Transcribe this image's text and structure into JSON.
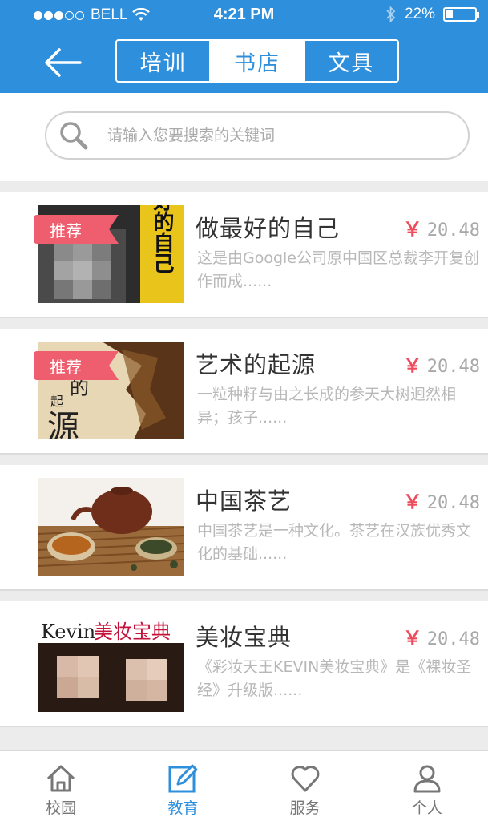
{
  "status_bar": {
    "carrier": "BELL",
    "time": "4:21 PM",
    "battery": "22%"
  },
  "header": {
    "segments": [
      {
        "label": "培训",
        "active": false
      },
      {
        "label": "书店",
        "active": true
      },
      {
        "label": "文具",
        "active": false
      }
    ]
  },
  "search": {
    "placeholder": "请输入您要搜索的关键词"
  },
  "books": [
    {
      "title": "做最好的自己",
      "currency": "￥",
      "price": "20.48",
      "badge": "推荐",
      "desc": "这是由Google公司原中国区总裁李开复创作而成......"
    },
    {
      "title": "艺术的起源",
      "currency": "￥",
      "price": "20.48",
      "badge": "推荐",
      "desc": "一粒种籽与由之长成的参天大树迥然相异；孩子......"
    },
    {
      "title": "中国茶艺",
      "currency": "￥",
      "price": "20.48",
      "badge": "",
      "desc": "中国茶艺是一种文化。茶艺在汉族优秀文化的基础......"
    },
    {
      "title": "美妆宝典",
      "currency": "￥",
      "price": "20.48",
      "badge": "",
      "desc": "《彩妆天王KEVIN美妆宝典》是《裸妆圣经》升级版......"
    }
  ],
  "cover_text": {
    "book1": "最好的自己",
    "book2_a": "的",
    "book2_b": "起",
    "book2_c": "源",
    "book4_a": "Kevin",
    "book4_b": "美妆宝典"
  },
  "tabbar": {
    "tabs": [
      {
        "label": "校园",
        "icon": "home-icon",
        "active": false
      },
      {
        "label": "教育",
        "icon": "edit-icon",
        "active": true
      },
      {
        "label": "服务",
        "icon": "heart-icon",
        "active": false
      },
      {
        "label": "个人",
        "icon": "user-icon",
        "active": false
      }
    ]
  },
  "colors": {
    "primary": "#2e8fdc",
    "badge": "#ee5e6e",
    "price_symbol": "#ee4c5c"
  }
}
